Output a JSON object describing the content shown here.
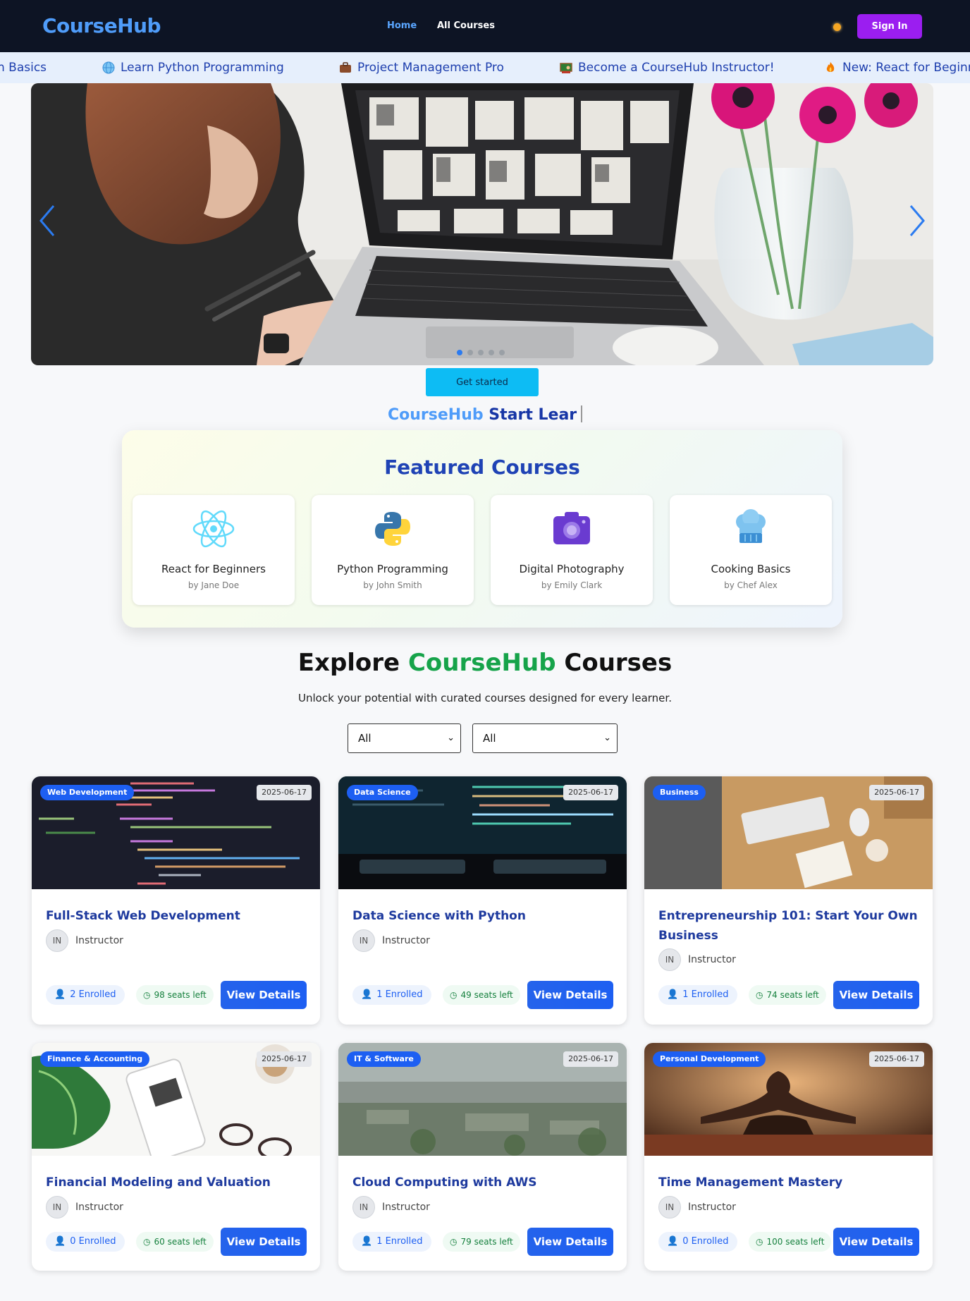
{
  "header": {
    "brand": "CourseHub",
    "nav": {
      "home": "Home",
      "all_courses": "All Courses"
    },
    "sign_in": "Sign In"
  },
  "ticker": [
    {
      "icon": "",
      "label": "n Basics"
    },
    {
      "icon": "globe-icon",
      "label": "Learn Python Programming"
    },
    {
      "icon": "briefcase-icon",
      "label": "Project Management Pro"
    },
    {
      "icon": "teacher-icon",
      "label": "Become a CourseHub Instructor!"
    },
    {
      "icon": "fire-icon",
      "label": "New: React for Beginn"
    }
  ],
  "hero": {
    "cta": "Get started",
    "typed_brand": "CourseHub",
    "typed_text": "Start Lear"
  },
  "featured": {
    "title": "Featured Courses",
    "items": [
      {
        "name": "React for Beginners",
        "by": "by Jane Doe",
        "icon": "react-icon"
      },
      {
        "name": "Python Programming",
        "by": "by John Smith",
        "icon": "python-icon"
      },
      {
        "name": "Digital Photography",
        "by": "by Emily Clark",
        "icon": "camera-icon"
      },
      {
        "name": "Cooking Basics",
        "by": "by Chef Alex",
        "icon": "chef-hat-icon"
      }
    ]
  },
  "explore": {
    "title_pre": "Explore",
    "title_brand": "CourseHub",
    "title_post": "Courses",
    "subtitle": "Unlock your potential with curated courses designed for every learner.",
    "filter1": "All",
    "filter2": "All"
  },
  "courses": [
    {
      "category": "Web Development",
      "date": "2025-06-17",
      "title": "Full-Stack Web Development",
      "instructor_initials": "IN",
      "instructor": "Instructor",
      "enrolled": "2 Enrolled",
      "seats": "98 seats left",
      "cta": "View Details"
    },
    {
      "category": "Data Science",
      "date": "2025-06-17",
      "title": "Data Science with Python",
      "instructor_initials": "IN",
      "instructor": "Instructor",
      "enrolled": "1 Enrolled",
      "seats": "49 seats left",
      "cta": "View Details"
    },
    {
      "category": "Business",
      "date": "2025-06-17",
      "title": "Entrepreneurship 101: Start Your Own Business",
      "instructor_initials": "IN",
      "instructor": "Instructor",
      "enrolled": "1 Enrolled",
      "seats": "74 seats left",
      "cta": "View Details"
    },
    {
      "category": "Finance & Accounting",
      "date": "2025-06-17",
      "title": "Financial Modeling and Valuation",
      "instructor_initials": "IN",
      "instructor": "Instructor",
      "enrolled": "0 Enrolled",
      "seats": "60 seats left",
      "cta": "View Details"
    },
    {
      "category": "IT & Software",
      "date": "2025-06-17",
      "title": "Cloud Computing with AWS",
      "instructor_initials": "IN",
      "instructor": "Instructor",
      "enrolled": "1 Enrolled",
      "seats": "79 seats left",
      "cta": "View Details"
    },
    {
      "category": "Personal Development",
      "date": "2025-06-17",
      "title": "Time Management Mastery",
      "instructor_initials": "IN",
      "instructor": "Instructor",
      "enrolled": "0 Enrolled",
      "seats": "100 seats left",
      "cta": "View Details"
    }
  ],
  "colors": {
    "header_bg": "#0d1424",
    "brand_blue": "#4f9cf9",
    "sign_in_purple": "#9b1ef0",
    "primary_blue": "#1d5ff2",
    "success_green": "#16a34a"
  }
}
